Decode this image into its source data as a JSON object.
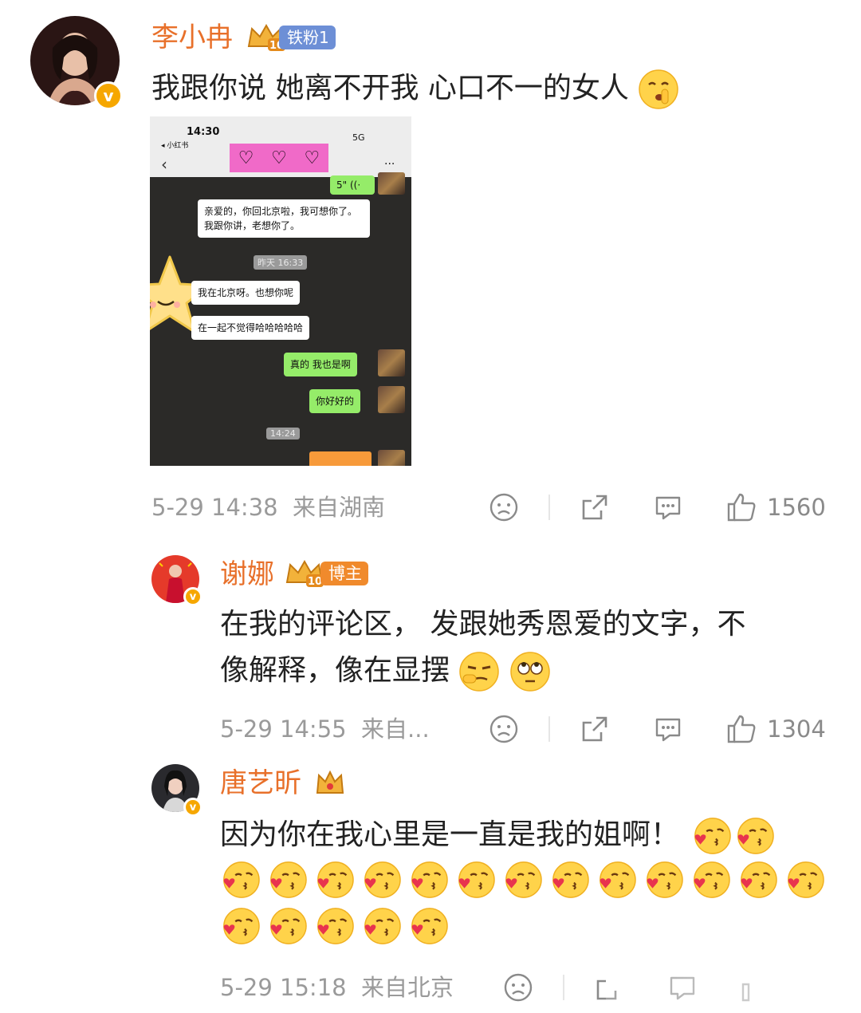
{
  "comments": [
    {
      "username": "李小冉",
      "badge": "铁粉1",
      "text": "我跟你说 她离不开我 心口不一的女人",
      "time": "5-29 14:38",
      "location": "来自湖南",
      "likes": "1560"
    },
    {
      "username": "谢娜",
      "badge": "博主",
      "text_line1": "在我的评论区， 发跟她秀恩爱的文字，不",
      "text_line2": "像解释，像在显摆",
      "time": "5-29 14:55",
      "location": "来自...",
      "likes": "1304"
    },
    {
      "username": "唐艺昕",
      "text": "因为你在我心里是一直是我的姐啊！",
      "time": "5-29 15:18",
      "location": "来自北京",
      "kiss_emoji_count": 20
    }
  ],
  "chat_screenshot": {
    "status_time": "14:30",
    "back_app": "◂ 小红书",
    "signal": "5G",
    "voice_duration": "5\"",
    "msg1": "亲爱的，你回北京啦，我可想你了。我跟你讲，老想你了。",
    "time1": "昨天 16:33",
    "msg2": "我在北京呀。也想你呢",
    "msg3": "在一起不觉得哈哈哈哈哈",
    "msg4": "真的 我也是啊",
    "msg5": "你好好的",
    "time2": "14:24"
  },
  "icons": [
    "verified-icon",
    "crown-icon",
    "dislike-icon",
    "share-icon",
    "comment-icon",
    "like-icon"
  ],
  "colors": {
    "username": "#e8702a",
    "badge_blue": "#6d8fd6",
    "badge_orange": "#f08a2c",
    "meta_gray": "#9a9a9a"
  }
}
